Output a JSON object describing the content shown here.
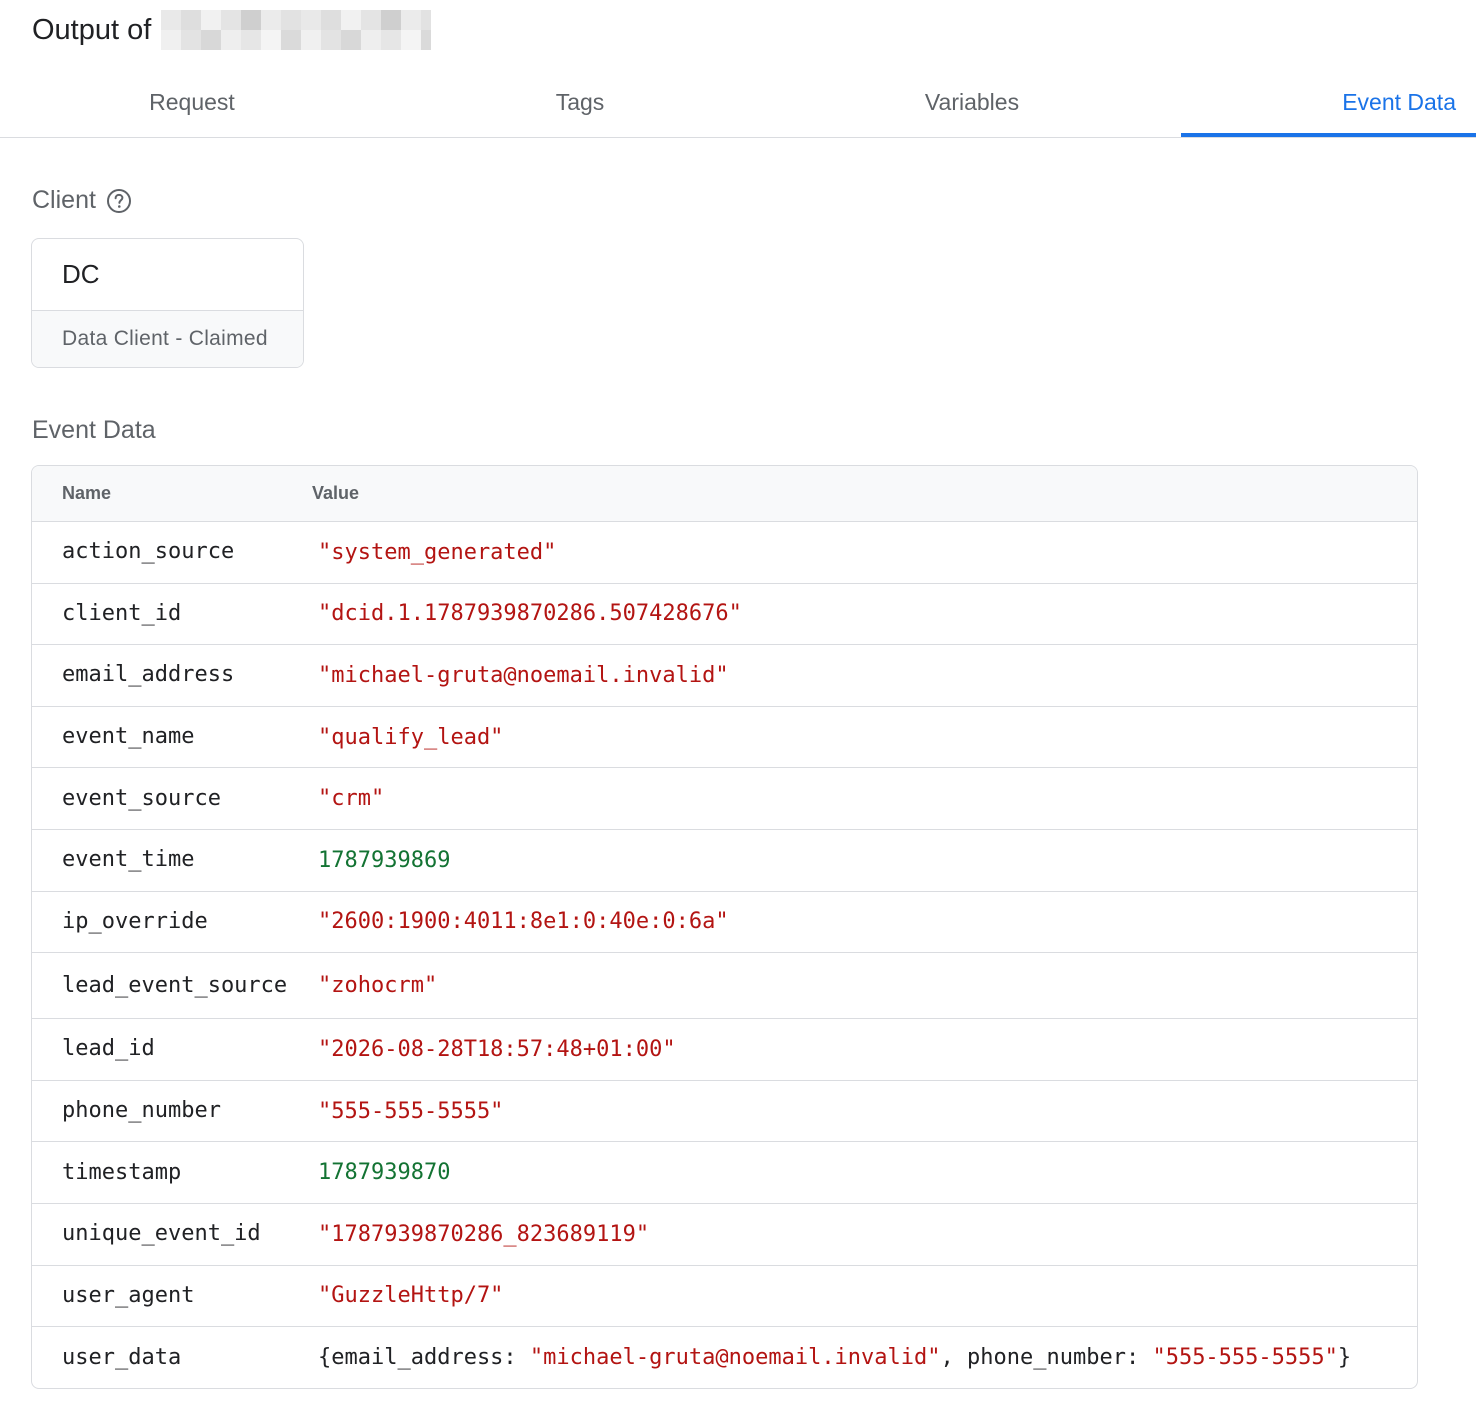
{
  "header": {
    "title": "Output of"
  },
  "tabs": [
    {
      "label": "Request",
      "active": false
    },
    {
      "label": "Tags",
      "active": false
    },
    {
      "label": "Variables",
      "active": false
    },
    {
      "label": "Event Data",
      "active": true
    }
  ],
  "client": {
    "label": "Client",
    "abbr": "DC",
    "name": "Data Client - Claimed"
  },
  "event_data": {
    "label": "Event Data",
    "columns": {
      "name": "Name",
      "value": "Value"
    },
    "rows": [
      {
        "name": "action_source",
        "value": "\"system_generated\"",
        "type": "string"
      },
      {
        "name": "client_id",
        "value": "\"dcid.1.1787939870286.507428676\"",
        "type": "string"
      },
      {
        "name": "email_address",
        "value": "\"michael-gruta@noemail.invalid\"",
        "type": "string"
      },
      {
        "name": "event_name",
        "value": "\"qualify_lead\"",
        "type": "string"
      },
      {
        "name": "event_source",
        "value": "\"crm\"",
        "type": "string"
      },
      {
        "name": "event_time",
        "value": "1787939869",
        "type": "number"
      },
      {
        "name": "ip_override",
        "value": "\"2600:1900:4011:8e1:0:40e:0:6a\"",
        "type": "string"
      },
      {
        "name": "lead_event_source",
        "value": "\"zohocrm\"",
        "type": "string"
      },
      {
        "name": "lead_id",
        "value": "\"2026-08-28T18:57:48+01:00\"",
        "type": "string"
      },
      {
        "name": "phone_number",
        "value": "\"555-555-5555\"",
        "type": "string"
      },
      {
        "name": "timestamp",
        "value": "1787939870",
        "type": "number"
      },
      {
        "name": "unique_event_id",
        "value": "\"1787939870286_823689119\"",
        "type": "string"
      },
      {
        "name": "user_agent",
        "value": "\"GuzzleHttp/7\"",
        "type": "string"
      },
      {
        "name": "user_data",
        "type": "object",
        "parts": [
          {
            "text": "{email_address: ",
            "type": "plain"
          },
          {
            "text": "\"michael-gruta@noemail.invalid\"",
            "type": "string"
          },
          {
            "text": ", phone_number: ",
            "type": "plain"
          },
          {
            "text": "\"555-555-5555\"",
            "type": "string"
          },
          {
            "text": "}",
            "type": "plain"
          }
        ]
      }
    ]
  },
  "colors": {
    "accent": "#1a73e8",
    "string": "#b31412",
    "number": "#137333"
  },
  "icons": {
    "help": "help-circle-icon"
  }
}
